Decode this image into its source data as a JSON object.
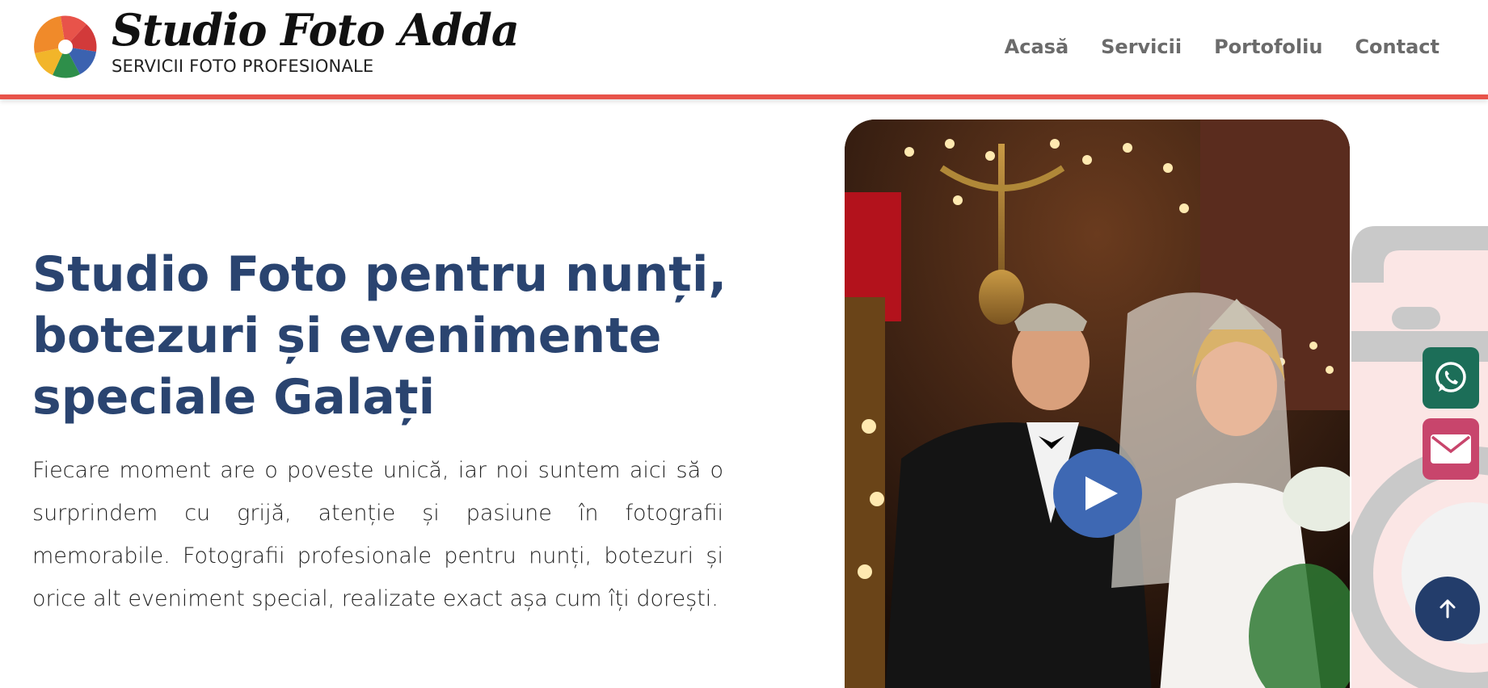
{
  "brand": {
    "name": "Studio Foto Adda",
    "tagline": "SERVICII FOTO PROFESIONALE"
  },
  "nav": {
    "items": [
      {
        "label": "Acasă"
      },
      {
        "label": "Servicii"
      },
      {
        "label": "Portofoliu"
      },
      {
        "label": "Contact"
      }
    ]
  },
  "hero": {
    "title": "Studio Foto pentru nunți, botezuri și evenimente speciale Galați",
    "text": "Fiecare moment are o poveste unică, iar noi suntem aici să o surprindem cu grijă, atenție și pasiune în fotografii memorabile. Fotografii profesionale pentru nunți, botezuri și orice alt eveniment special, realizate exact așa cum îți dorești."
  },
  "icons": {
    "logo": "aperture-logo-icon",
    "play": "play-icon",
    "whatsapp": "whatsapp-icon",
    "email": "envelope-icon",
    "scroll_top": "arrow-up-icon"
  },
  "colors": {
    "accent": "#e8534a",
    "title": "#2a4470",
    "play": "#3e68b3",
    "whatsapp": "#1c6e58",
    "email": "#c8456c",
    "scroll_top": "#233d6b"
  }
}
